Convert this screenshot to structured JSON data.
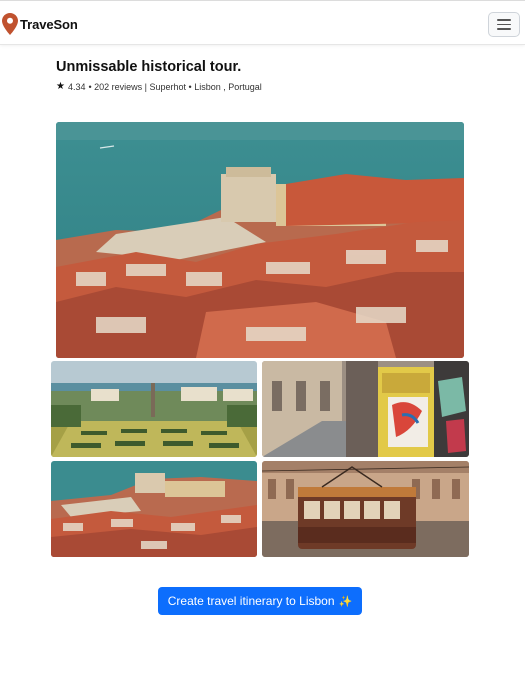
{
  "header": {
    "brand_name": "TraveSon",
    "logo_icon": "map-pin-icon",
    "menu_icon": "hamburger-menu-icon",
    "brand_color": "#c0522f"
  },
  "tour": {
    "title": "Unmissable historical tour.",
    "rating_icon": "star-icon",
    "rating": "4.34",
    "details": "• 202 reviews | Superhot • Lisbon , Portugal"
  },
  "gallery": {
    "images": [
      {
        "name": "lisbon-harbor-rooftops-photo"
      },
      {
        "name": "park-garden-photo"
      },
      {
        "name": "tram-street-graffiti-photo"
      },
      {
        "name": "lisbon-rooftops-sea-photo"
      },
      {
        "name": "vintage-tram-photo"
      }
    ]
  },
  "cta": {
    "label": "Create travel itinerary to Lisbon",
    "icon": "sparkle-icon",
    "color": "#0d6efd"
  }
}
